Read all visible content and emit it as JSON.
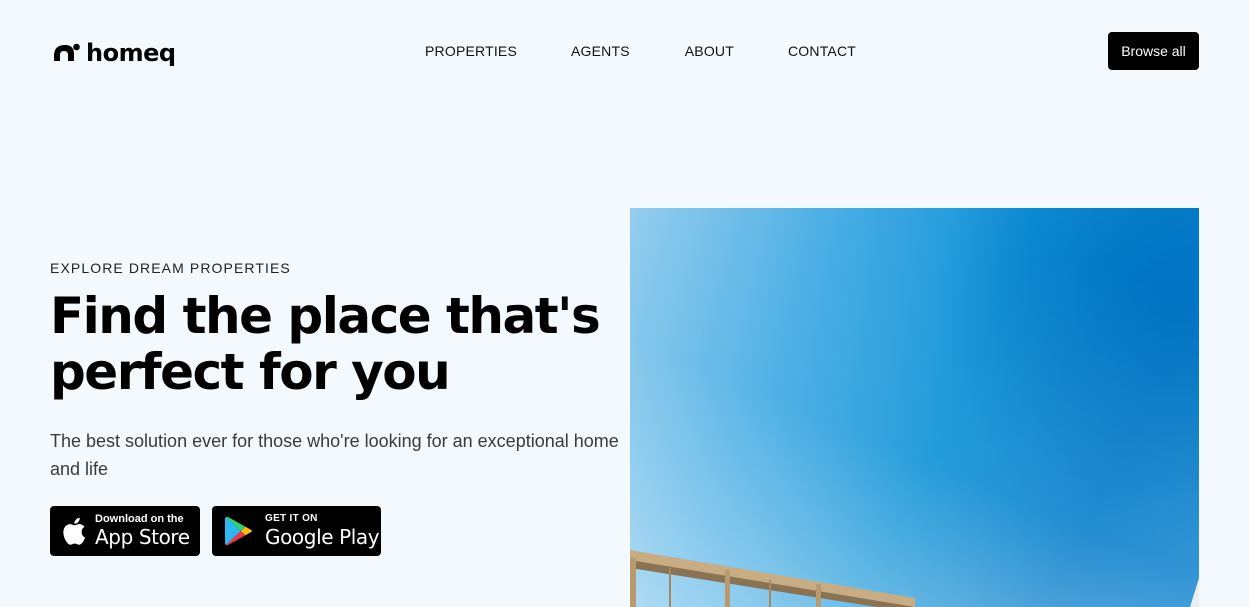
{
  "brand": {
    "name": "homeq"
  },
  "nav": {
    "items": [
      {
        "label": "PROPERTIES"
      },
      {
        "label": "AGENTS"
      },
      {
        "label": "ABOUT"
      },
      {
        "label": "CONTACT"
      }
    ],
    "cta_label": "Browse all"
  },
  "hero": {
    "eyebrow": "EXPLORE DREAM PROPERTIES",
    "headline": "Find the place that's perfect for you",
    "subtext": "The best solution ever for those who're looking for an exceptional home and life",
    "image_icon": "pergola-under-blue-sky-photo"
  },
  "stores": {
    "apple": {
      "small": "Download on the",
      "big": "App Store",
      "icon": "apple-icon"
    },
    "google": {
      "small": "GET IT ON",
      "big": "Google Play",
      "icon": "google-play-icon"
    }
  },
  "colors": {
    "background": "#f4f9fd",
    "text": "#000000",
    "button_bg": "#000000",
    "button_text": "#ffffff",
    "sky_blue": "#0a7fcb"
  }
}
